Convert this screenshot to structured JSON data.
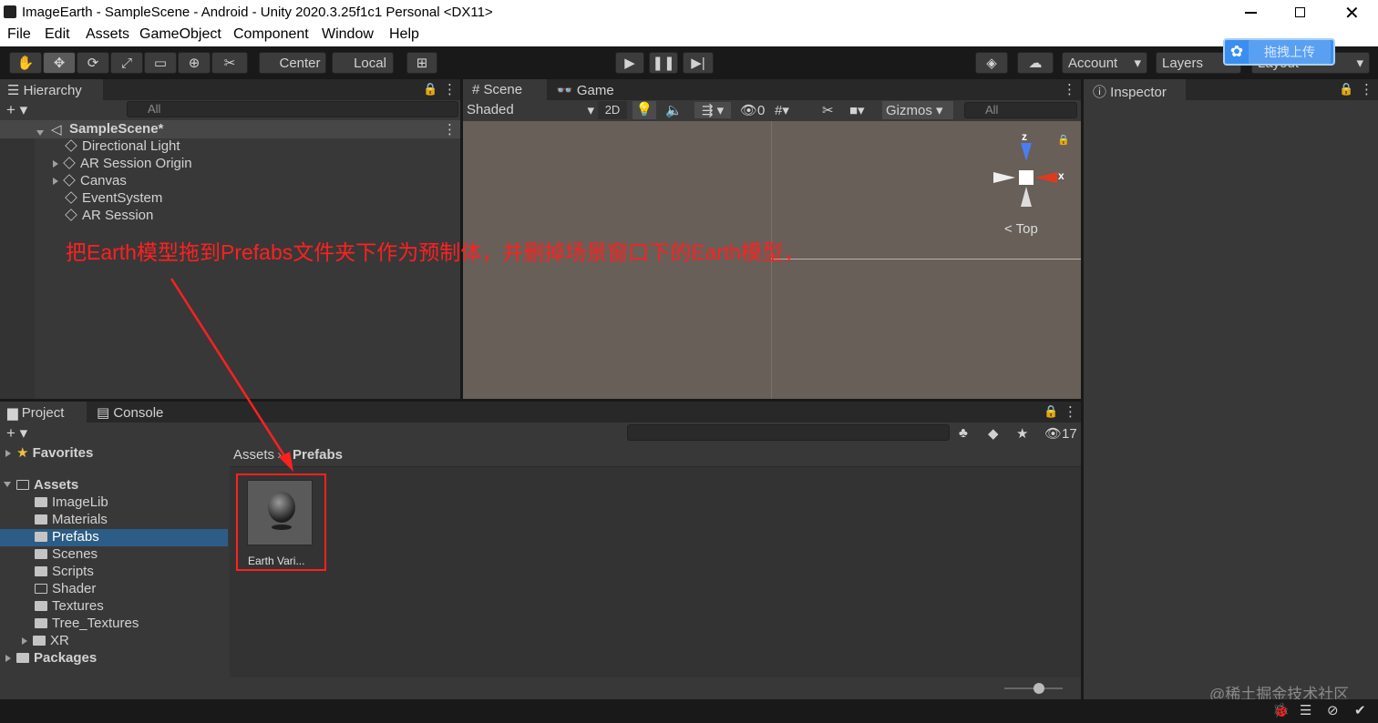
{
  "window": {
    "title": "ImageEarth - SampleScene - Android - Unity 2020.3.25f1c1 Personal <DX11>"
  },
  "menu": [
    "File",
    "Edit",
    "Assets",
    "GameObject",
    "Component",
    "Window",
    "Help"
  ],
  "toolbar": {
    "center": "Center",
    "local": "Local",
    "account": "Account",
    "layers": "Layers",
    "layout": "Layout"
  },
  "upload_badge": "拖拽上传",
  "hierarchy": {
    "tab": "Hierarchy",
    "search_placeholder": "All",
    "scene": "SampleScene*",
    "items": [
      {
        "label": "Directional Light",
        "expandable": false
      },
      {
        "label": "AR Session Origin",
        "expandable": true
      },
      {
        "label": "Canvas",
        "expandable": true
      },
      {
        "label": "EventSystem",
        "expandable": false
      },
      {
        "label": "AR Session",
        "expandable": false
      }
    ]
  },
  "scene_view": {
    "tabs": [
      "Scene",
      "Game"
    ],
    "shading": "Shaded",
    "mode_2d": "2D",
    "hidden_count": "0",
    "gizmos": "Gizmos",
    "search_placeholder": "All",
    "axis_z": "z",
    "axis_x": "x",
    "view_label": "Top"
  },
  "inspector": {
    "tab": "Inspector"
  },
  "project": {
    "tabs": [
      "Project",
      "Console"
    ],
    "hidden_count": "17",
    "favorites": "Favorites",
    "assets": "Assets",
    "folders": [
      "ImageLib",
      "Materials",
      "Prefabs",
      "Scenes",
      "Scripts",
      "Shader",
      "Textures",
      "Tree_Textures",
      "XR"
    ],
    "selected_folder": "Prefabs",
    "packages": "Packages",
    "breadcrumb": [
      "Assets",
      "Prefabs"
    ],
    "asset_name": "Earth Vari..."
  },
  "annotation": "把Earth模型拖到Prefabs文件夹下作为预制体，并删掉场景窗口下的Earth模型，",
  "watermark": "@稀土掘金技术社区",
  "colors": {
    "annotation": "#ff2020",
    "selection": "#2c5d87",
    "scene_bg": "#675f58"
  }
}
